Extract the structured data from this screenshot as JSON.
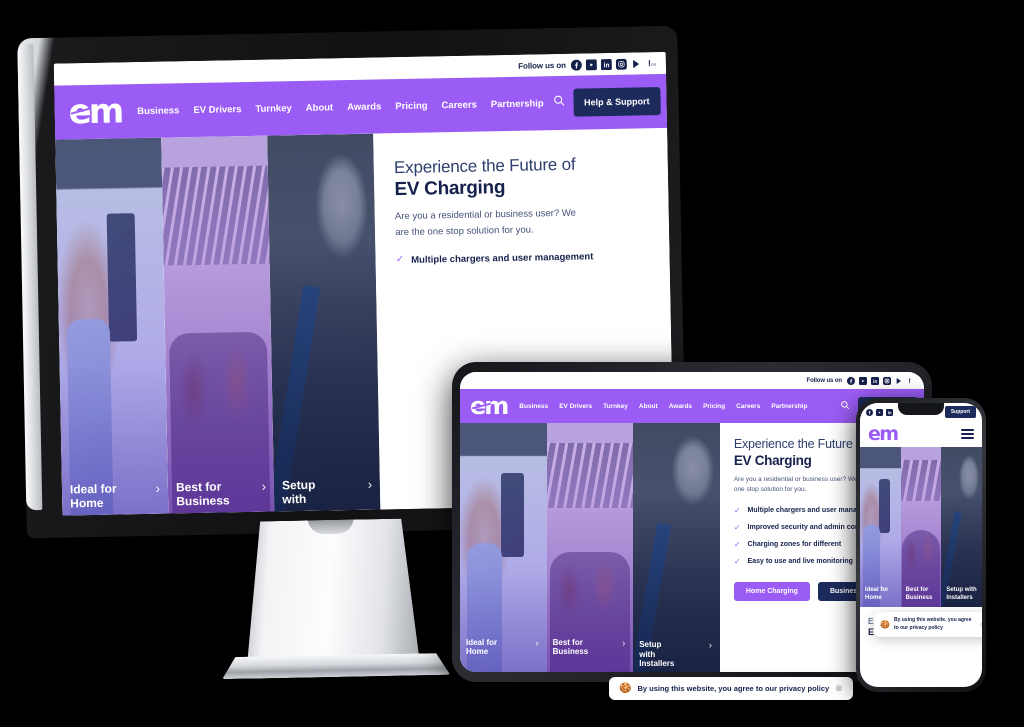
{
  "brand": {
    "logo_text": "em",
    "accent_purple": "#9b5cf5",
    "navy": "#1d2a5c",
    "heading_navy": "#16214d"
  },
  "topbar": {
    "follow_label": "Follow us on",
    "social_icons": [
      "facebook-icon",
      "youtube-icon",
      "linkedin-icon",
      "instagram-icon",
      "google-play-icon",
      "app-store-icon"
    ]
  },
  "nav": {
    "items": [
      {
        "label": "Business"
      },
      {
        "label": "EV Drivers"
      },
      {
        "label": "Turnkey"
      },
      {
        "label": "About"
      },
      {
        "label": "Awards"
      },
      {
        "label": "Pricing"
      },
      {
        "label": "Careers"
      },
      {
        "label": "Partnership"
      }
    ],
    "search_icon": "search-icon",
    "help_button": "Help & Support",
    "phone_support_button": "Support",
    "menu_icon": "hamburger-menu-icon"
  },
  "hero": {
    "title_line1": "Experience the Future of",
    "title_line2": "EV Charging",
    "subtitle": "Are you a residential or business user? We are the one stop solution for you.",
    "bullets": [
      "Multiple chargers and user management",
      "Improved security and admin controls",
      "Charging zones for different",
      "Easy to use and live monitoring"
    ],
    "cta_primary": "Home Charging",
    "cta_secondary": "Business Charging"
  },
  "gallery": {
    "cards": [
      {
        "title_line1": "Ideal for",
        "title_line2": "Home",
        "title_line3": "",
        "full_title": "Ideal for Home",
        "chevron": "›"
      },
      {
        "title_line1": "Best for",
        "title_line2": "Business",
        "title_line3": "",
        "full_title": "Best for Business",
        "chevron": "›"
      },
      {
        "title_line1": "Setup",
        "title_line2": "with",
        "title_line3": "Installers",
        "full_title": "Setup with Installers",
        "chevron": "›"
      }
    ]
  },
  "cookie": {
    "icon": "cookie-icon",
    "message": "By using this website, you agree to our privacy policy",
    "message_phone": "By using this website, you agree to our privacy policy",
    "close_icon": "⊗"
  }
}
